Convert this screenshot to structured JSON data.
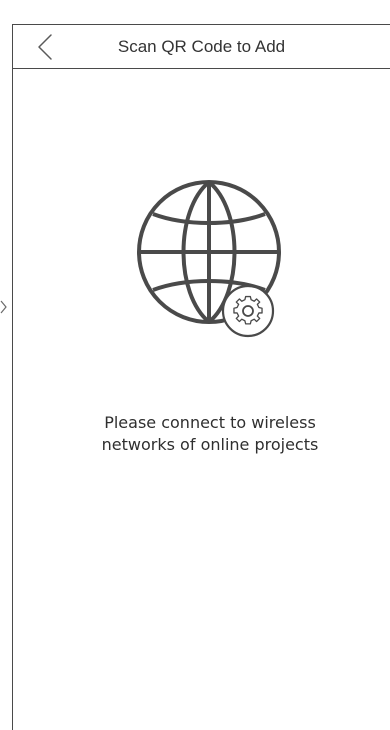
{
  "header": {
    "title": "Scan QR Code to Add",
    "back_icon": "chevron-left-icon"
  },
  "main": {
    "illustration_icon": "globe-gear-icon",
    "message_line1": "Please connect to wireless",
    "message_line2": "networks of online projects"
  },
  "colors": {
    "stroke": "#4a4a4a",
    "text": "#333333",
    "background": "#ffffff"
  }
}
